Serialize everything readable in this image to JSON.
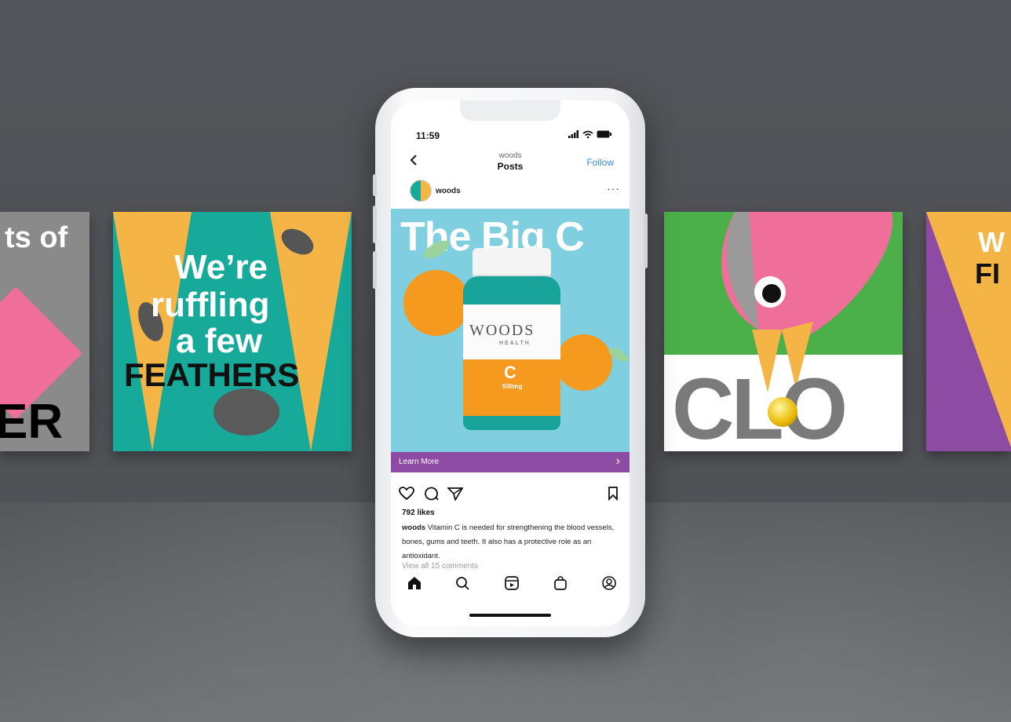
{
  "cards": {
    "left_partial": {
      "top_text": "ts of",
      "bottom_text": "ER"
    },
    "feathers": {
      "line1": "We’re",
      "line2": "ruffling",
      "line3": "a few",
      "line4": "FEATHERS"
    },
    "clo": {
      "text": "CLO"
    },
    "right_partial": {
      "line1": "W",
      "line2": "FI"
    }
  },
  "phone": {
    "status": {
      "time": "11:59",
      "signal": "signal-icon",
      "wifi": "wifi-icon",
      "battery": "battery-icon"
    },
    "header": {
      "account_name": "woods",
      "title": "Posts",
      "follow_label": "Follow"
    },
    "post_author": {
      "username": "woods",
      "more": "···"
    },
    "post_image": {
      "headline": "The Big C",
      "bottle_brand": "WOODS",
      "bottle_sub": "HEALTH",
      "bottle_letter": "C",
      "bottle_dose": "500mg"
    },
    "cta": {
      "label": "Learn More",
      "chevron": "›"
    },
    "likes": "792 likes",
    "caption": {
      "username": "woods",
      "text": "Vitamin C is needed for strengthening the blood vessels, bones, gums and teeth. It also has a protective role as an antioxidant."
    },
    "comments_link": "View all 15 comments"
  },
  "colors": {
    "teal": "#17a99a",
    "mustard": "#f4b446",
    "purple": "#8e4ba4",
    "green": "#4cb04a",
    "pink": "#ef6f9a",
    "sky": "#7fcfe0",
    "orange": "#f59a1f"
  }
}
